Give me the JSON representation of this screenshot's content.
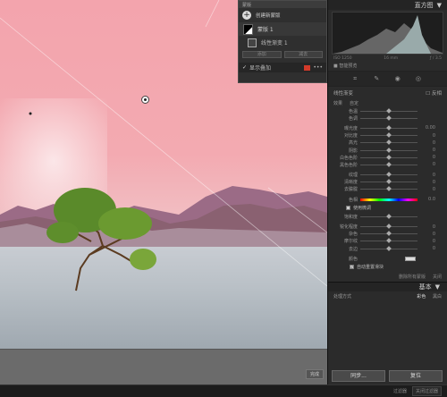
{
  "mask_panel": {
    "title": "蒙版",
    "create_label": "创建新蒙版",
    "masks": [
      {
        "name": "蒙版 1"
      },
      {
        "name": "线性渐变 1"
      }
    ],
    "add_label": "添加",
    "subtract_label": "减去",
    "show_overlay_label": "显示叠加",
    "overlay_color": "#d23a2a"
  },
  "canvas": {
    "bottom_button": "完成"
  },
  "right_panel": {
    "histogram_title": "直方图",
    "hist_info": {
      "iso": "ISO 1250",
      "focal": "16 mm",
      "aperture": "ƒ / 3.5"
    },
    "original_preview_label": "智能预览",
    "mask_effect_title": "线性渐变",
    "mask_effect_reverse": "反相",
    "effect_label": "效果",
    "effect_value": "自定",
    "sliders_group1": [
      {
        "label": "色温",
        "value": ""
      },
      {
        "label": "色调",
        "value": ""
      }
    ],
    "sliders_group2": [
      {
        "label": "曝光度",
        "value": "0.00"
      },
      {
        "label": "对比度",
        "value": "0"
      },
      {
        "label": "高光",
        "value": "0"
      },
      {
        "label": "阴影",
        "value": "0"
      },
      {
        "label": "白色色阶",
        "value": "0"
      },
      {
        "label": "黑色色阶",
        "value": "0"
      }
    ],
    "sliders_group3": [
      {
        "label": "纹理",
        "value": "0"
      },
      {
        "label": "清晰度",
        "value": "0"
      },
      {
        "label": "去朦胧",
        "value": "0"
      }
    ],
    "hue_label": "色相",
    "hue_value": "0.0",
    "use_fine_label": "使用微调",
    "saturation_label": "饱和度",
    "sliders_group4": [
      {
        "label": "锐化程度",
        "value": "0"
      },
      {
        "label": "杂色",
        "value": "0"
      },
      {
        "label": "摩尔纹",
        "value": "0"
      },
      {
        "label": "去边",
        "value": "0"
      }
    ],
    "color_label": "颜色",
    "auto_reset_label": "自动重置滑块",
    "delete_all_label": "删除所有蒙版",
    "close_label": "关闭",
    "basic_title": "基本",
    "process_label": "处理方式",
    "process_options": [
      "彩色",
      "黑白"
    ],
    "prev_button": "同步...",
    "reset_button": "复位"
  },
  "statusbar": {
    "filter_label": "过滤器",
    "filter_button": "关闭过滤器"
  },
  "colors": {
    "sky_pink": "#f3a4ad",
    "panel_bg": "#2b2b2b",
    "overlay_red": "#d23a2a"
  }
}
